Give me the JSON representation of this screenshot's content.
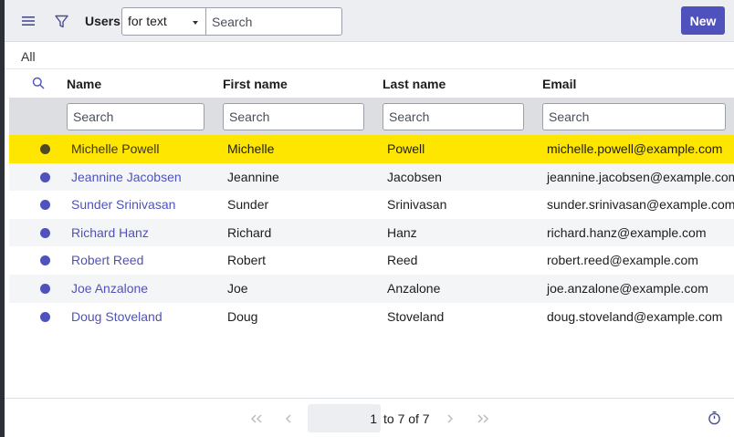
{
  "header": {
    "title": "Users",
    "search_type": "for text",
    "search_placeholder": "Search",
    "new_label": "New"
  },
  "breadcrumb": "All",
  "columns": {
    "name": "Name",
    "first_name": "First name",
    "last_name": "Last name",
    "email": "Email"
  },
  "filters": {
    "name_placeholder": "Search",
    "first_placeholder": "Search",
    "last_placeholder": "Search",
    "email_placeholder": "Search"
  },
  "rows": [
    {
      "name": "Michelle Powell",
      "first": "Michelle",
      "last": "Powell",
      "email": "michelle.powell@example.com",
      "selected": true
    },
    {
      "name": "Jeannine Jacobsen",
      "first": "Jeannine",
      "last": "Jacobsen",
      "email": "jeannine.jacobsen@example.com"
    },
    {
      "name": "Sunder Srinivasan",
      "first": "Sunder",
      "last": "Srinivasan",
      "email": "sunder.srinivasan@example.com"
    },
    {
      "name": "Richard Hanz",
      "first": "Richard",
      "last": "Hanz",
      "email": "richard.hanz@example.com"
    },
    {
      "name": "Robert Reed",
      "first": "Robert",
      "last": "Reed",
      "email": "robert.reed@example.com"
    },
    {
      "name": "Joe Anzalone",
      "first": "Joe",
      "last": "Anzalone",
      "email": "joe.anzalone@example.com"
    },
    {
      "name": "Doug Stoveland",
      "first": "Doug",
      "last": "Stoveland",
      "email": "doug.stoveland@example.com"
    }
  ],
  "pager": {
    "page": "1",
    "range_text": "to 7 of 7"
  },
  "colors": {
    "accent": "#4f52bd",
    "selected_row": "#ffe600"
  },
  "icons": [
    "menu-icon",
    "filter-icon",
    "column-search-icon",
    "first-page-icon",
    "previous-page-icon",
    "next-page-icon",
    "last-page-icon",
    "timer-icon"
  ]
}
